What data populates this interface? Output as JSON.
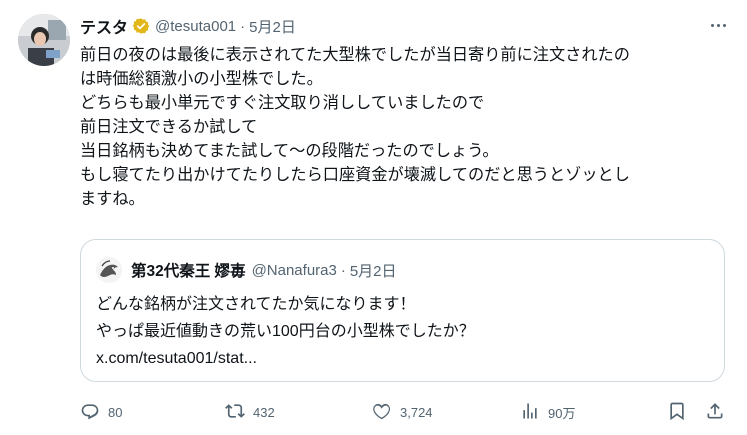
{
  "tweet": {
    "author_name": "テスタ",
    "handle": "@tesuta001",
    "separator": "·",
    "date": "5月2日",
    "body_lines": [
      "前日の夜のは最後に表示されてた大型株でしたが当日寄り前に注文されたの",
      "は時価総額激小の小型株でした。",
      "どちらも最小単元ですぐ注文取り消ししていましたので",
      "前日注文できるか試して",
      "当日銘柄も決めてまた試して〜の段階だったのでしょう。",
      "もし寝てたり出かけてたりしたら口座資金が壊滅してのだと思うとゾッとし",
      "ますね。"
    ]
  },
  "quote": {
    "author_name": "第32代秦王 嫪毐",
    "handle": "@Nanafura3",
    "separator": "·",
    "date": "5月2日",
    "body_lines": [
      "どんな銘柄が注文されてたか気になります！",
      "やっぱ最近値動きの荒い100円台の小型株でしたか？",
      "x.com/tesuta001/stat..."
    ]
  },
  "actions": {
    "reply_count": "80",
    "retweet_count": "432",
    "like_count": "3,724",
    "view_count": "90万"
  },
  "colors": {
    "text": "#0f1419",
    "secondary": "#536471",
    "border": "#cfd9de",
    "verified_gold": "#e2b719"
  },
  "icons": [
    "more-icon",
    "verified-badge-icon",
    "reply-icon",
    "retweet-icon",
    "like-icon",
    "views-icon",
    "bookmark-icon",
    "share-icon"
  ]
}
